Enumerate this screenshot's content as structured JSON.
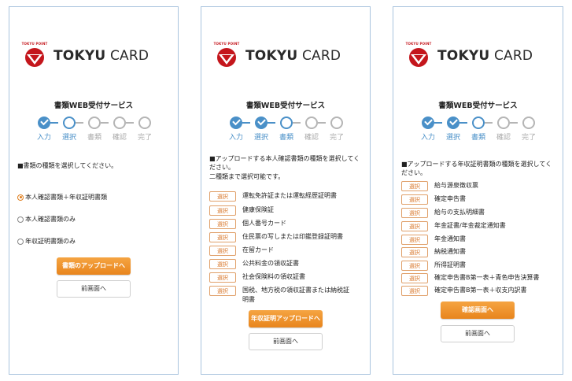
{
  "brand": {
    "small_text": "TOKYU POINT",
    "name_bold": "TOKYU",
    "name_light": " CARD",
    "red": "#c4161c"
  },
  "service_title": "書類WEB受付サービス",
  "steps": [
    "入力",
    "選択",
    "書類",
    "確認",
    "完了"
  ],
  "colors": {
    "accent": "#4a90c8",
    "button": "#e8851d",
    "select_border": "#e0a06a"
  },
  "panel1": {
    "instruction": "■書類の種類を選択してください。",
    "options": [
      "本人確認書類＋年収証明書類",
      "本人確認書類のみ",
      "年収証明書類のみ"
    ],
    "selected_index": 0,
    "primary_button": "書類のアップロードへ",
    "secondary_button": "前画面へ"
  },
  "panel2": {
    "instruction": "■アップロードする本人確認書類の種類を選択してください。",
    "note": "二種類まで選択可能です。",
    "select_label": "選択",
    "items": [
      "運転免許証または運転経歴証明書",
      "健康保険証",
      "個人番号カード",
      "住民票の写しまたは印鑑登録証明書",
      "在留カード",
      "公共料金の領収証書",
      "社会保険料の領収証書",
      "国税、地方税の領収証書または納税証明書"
    ],
    "primary_button": "年収証明アップロードへ",
    "secondary_button": "前画面へ"
  },
  "panel3": {
    "instruction": "■アップロードする年収証明書類の種類を選択してください。",
    "select_label": "選択",
    "items": [
      "給与源泉徴収票",
      "確定申告書",
      "給与の支払明細書",
      "年金証書/年金裁定通知書",
      "年金通知書",
      "納税通知書",
      "所得証明書",
      "確定申告書B第一表＋青色申告決算書",
      "確定申告書B第一表＋収支内訳書"
    ],
    "primary_button": "確認画面へ",
    "secondary_button": "前画面へ"
  }
}
